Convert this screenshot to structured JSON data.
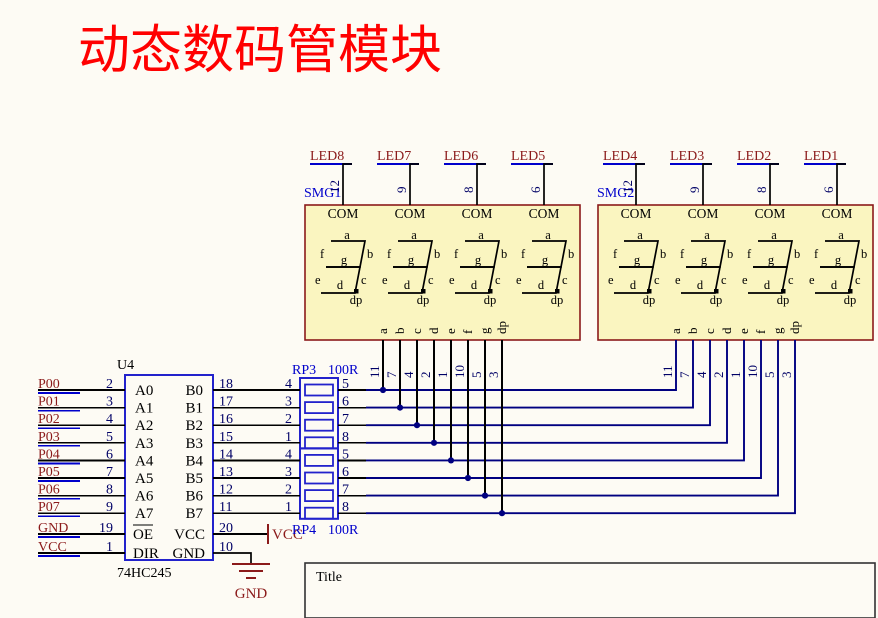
{
  "page": {
    "title_cn": "动态数码管模块",
    "title_color": "#ff0000",
    "background": "#fdfbf4",
    "wire_color": "#000000",
    "net_label_color": "#8b1a1a",
    "pin_number_color": "#000066",
    "designator_color": "#0000cc",
    "body_fill": "#faf5c0",
    "body_stroke": "#8b1a1a",
    "bus_color": "#000080"
  },
  "ic": {
    "designator": "U4",
    "part_number": "74HC245",
    "left_pins": [
      {
        "net": "P00",
        "pin": "2",
        "name": "A0"
      },
      {
        "net": "P01",
        "pin": "3",
        "name": "A1"
      },
      {
        "net": "P02",
        "pin": "4",
        "name": "A2"
      },
      {
        "net": "P03",
        "pin": "5",
        "name": "A3"
      },
      {
        "net": "P04",
        "pin": "6",
        "name": "A4"
      },
      {
        "net": "P05",
        "pin": "7",
        "name": "A5"
      },
      {
        "net": "P06",
        "pin": "8",
        "name": "A6"
      },
      {
        "net": "P07",
        "pin": "9",
        "name": "A7"
      }
    ],
    "right_pins": [
      {
        "pin": "18",
        "name": "B0"
      },
      {
        "pin": "17",
        "name": "B1"
      },
      {
        "pin": "16",
        "name": "B2"
      },
      {
        "pin": "15",
        "name": "B3"
      },
      {
        "pin": "14",
        "name": "B4"
      },
      {
        "pin": "13",
        "name": "B5"
      },
      {
        "pin": "12",
        "name": "B6"
      },
      {
        "pin": "11",
        "name": "B7"
      }
    ],
    "power_left": [
      {
        "net": "GND",
        "pin": "19",
        "name": "OE",
        "overbar": true
      },
      {
        "net": "VCC",
        "pin": "1",
        "name": "DIR",
        "overbar": false
      }
    ],
    "power_right": [
      {
        "pin": "20",
        "name": "VCC",
        "net": "VCC"
      },
      {
        "pin": "10",
        "name": "GND",
        "net": "GND"
      }
    ]
  },
  "resistor_networks": [
    {
      "designator": "RP3",
      "value": "100R",
      "left_pins": [
        "4",
        "3",
        "2",
        "1"
      ],
      "right_pins": [
        "5",
        "6",
        "7",
        "8"
      ]
    },
    {
      "designator": "RP4",
      "value": "100R",
      "left_pins": [
        "4",
        "3",
        "2",
        "1"
      ],
      "right_pins": [
        "5",
        "6",
        "7",
        "8"
      ]
    }
  ],
  "displays": [
    {
      "designator": "SMG1",
      "digits": [
        {
          "net": "LED8",
          "com_pin": "12"
        },
        {
          "net": "LED7",
          "com_pin": "9"
        },
        {
          "net": "LED6",
          "com_pin": "8"
        },
        {
          "net": "LED5",
          "com_pin": "6"
        }
      ],
      "com_label": "COM",
      "segment_letters": [
        "a",
        "b",
        "c",
        "d",
        "e",
        "f",
        "g",
        "dp"
      ],
      "segment_pins": [
        "11",
        "7",
        "4",
        "2",
        "1",
        "10",
        "5",
        "3"
      ]
    },
    {
      "designator": "SMG2",
      "digits": [
        {
          "net": "LED4",
          "com_pin": "12"
        },
        {
          "net": "LED3",
          "com_pin": "9"
        },
        {
          "net": "LED2",
          "com_pin": "8"
        },
        {
          "net": "LED1",
          "com_pin": "6"
        }
      ],
      "com_label": "COM",
      "segment_letters": [
        "a",
        "b",
        "c",
        "d",
        "e",
        "f",
        "g",
        "dp"
      ],
      "segment_pins": [
        "11",
        "7",
        "4",
        "2",
        "1",
        "10",
        "5",
        "3"
      ]
    }
  ],
  "digit_face": {
    "letters": {
      "a": "a",
      "b": "b",
      "c": "c",
      "d": "d",
      "e": "e",
      "f": "f",
      "g": "g",
      "dp": "dp"
    }
  },
  "power_symbols": [
    {
      "name": "VCC",
      "label": "VCC"
    },
    {
      "name": "GND",
      "label": "GND"
    }
  ],
  "title_block": {
    "title_text": "Title"
  }
}
